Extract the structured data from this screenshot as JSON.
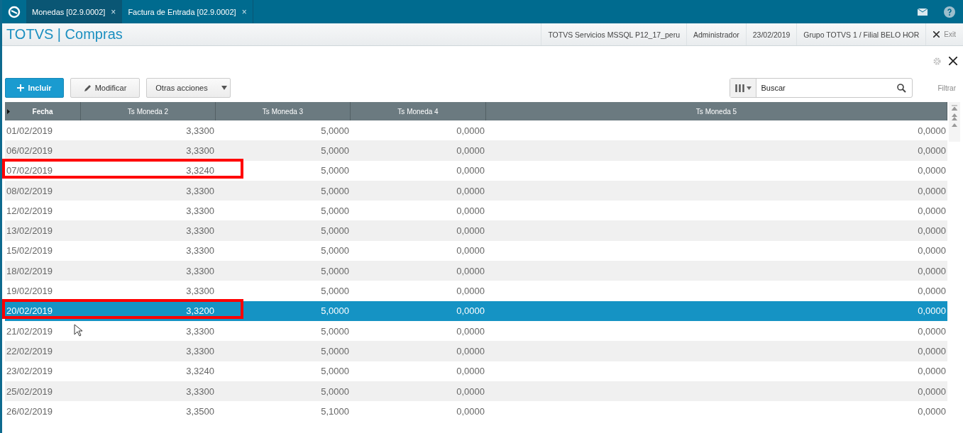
{
  "tabs": [
    {
      "label": "Monedas [02.9.0002]",
      "close": "×",
      "selected": true
    },
    {
      "label": "Factura de Entrada [02.9.0002]",
      "close": "×",
      "selected": false
    }
  ],
  "header": {
    "title": "TOTVS | Compras",
    "info": [
      "TOTVS Servicios MSSQL P12_17_peru",
      "Administrador",
      "23/02/2019",
      "Grupo TOTVS 1 / Filial BELO HOR"
    ],
    "exit": "Exit"
  },
  "toolbar": {
    "buttons": [
      {
        "label": "Incluir",
        "kind": "primary"
      },
      {
        "label": "Modificar",
        "kind": "edit"
      },
      {
        "label": "Otras acciones",
        "kind": "menu"
      }
    ],
    "search": {
      "placeholder": "Buscar"
    },
    "filter": "Filtrar"
  },
  "table": {
    "columns": [
      "Fecha",
      "Ts Moneda 2",
      "Ts Moneda 3",
      "Ts Moneda 4",
      "Ts Moneda 5"
    ],
    "rows": [
      {
        "cells": [
          "01/02/2019",
          "3,3300",
          "5,0000",
          "0,0000",
          "0,0000"
        ],
        "selected": false,
        "highlighted": false
      },
      {
        "cells": [
          "06/02/2019",
          "3,3300",
          "5,0000",
          "0,0000",
          "0,0000"
        ],
        "selected": false,
        "highlighted": false
      },
      {
        "cells": [
          "07/02/2019",
          "3,3240",
          "5,0000",
          "0,0000",
          "0,0000"
        ],
        "selected": false,
        "highlighted": true
      },
      {
        "cells": [
          "08/02/2019",
          "3,3300",
          "5,0000",
          "0,0000",
          "0,0000"
        ],
        "selected": false,
        "highlighted": false
      },
      {
        "cells": [
          "12/02/2019",
          "3,3300",
          "5,0000",
          "0,0000",
          "0,0000"
        ],
        "selected": false,
        "highlighted": false
      },
      {
        "cells": [
          "13/02/2019",
          "3,3300",
          "5,0000",
          "0,0000",
          "0,0000"
        ],
        "selected": false,
        "highlighted": false
      },
      {
        "cells": [
          "15/02/2019",
          "3,3300",
          "5,0000",
          "0,0000",
          "0,0000"
        ],
        "selected": false,
        "highlighted": false
      },
      {
        "cells": [
          "18/02/2019",
          "3,3300",
          "5,0000",
          "0,0000",
          "0,0000"
        ],
        "selected": false,
        "highlighted": false
      },
      {
        "cells": [
          "19/02/2019",
          "3,3300",
          "5,0000",
          "0,0000",
          "0,0000"
        ],
        "selected": false,
        "highlighted": false
      },
      {
        "cells": [
          "20/02/2019",
          "3,3200",
          "5,0000",
          "0,0000",
          "0,0000"
        ],
        "selected": true,
        "highlighted": true
      },
      {
        "cells": [
          "21/02/2019",
          "3,3300",
          "5,0000",
          "0,0000",
          "0,0000"
        ],
        "selected": false,
        "highlighted": false
      },
      {
        "cells": [
          "22/02/2019",
          "3,3300",
          "5,0000",
          "0,0000",
          "0,0000"
        ],
        "selected": false,
        "highlighted": false
      },
      {
        "cells": [
          "23/02/2019",
          "3,3240",
          "5,0000",
          "0,0000",
          "0,0000"
        ],
        "selected": false,
        "highlighted": false
      },
      {
        "cells": [
          "25/02/2019",
          "3,3300",
          "5,0000",
          "0,0000",
          "0,0000"
        ],
        "selected": false,
        "highlighted": false
      },
      {
        "cells": [
          "26/02/2019",
          "3,3500",
          "5,1000",
          "0,0000",
          "0,0000"
        ],
        "selected": false,
        "highlighted": false
      }
    ]
  }
}
